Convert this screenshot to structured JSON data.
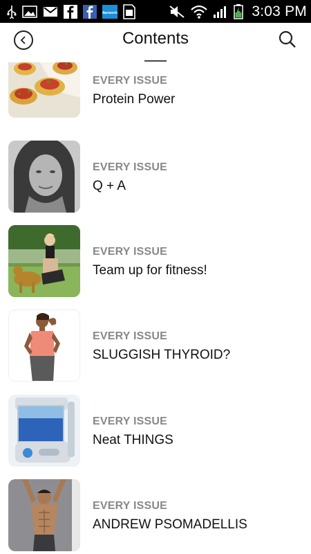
{
  "status_bar": {
    "time": "3:03 PM",
    "icons": [
      "usb-icon",
      "image-icon",
      "gmail-icon",
      "facebook-icon",
      "facebook-icon",
      "macworld-icon",
      "sim-icon",
      "mute-icon",
      "wifi-icon",
      "signal-icon",
      "battery-charging-icon"
    ],
    "macworld_label": "Macworld"
  },
  "header": {
    "title": "Contents"
  },
  "articles": [
    {
      "kicker": "EVERY ISSUE",
      "title": "Protein Power"
    },
    {
      "kicker": "EVERY ISSUE",
      "title": "Q + A"
    },
    {
      "kicker": "EVERY ISSUE",
      "title": "Team up for fitness!"
    },
    {
      "kicker": "EVERY ISSUE",
      "title": "SLUGGISH THYROID?"
    },
    {
      "kicker": "EVERY ISSUE",
      "title": "Neat THINGS"
    },
    {
      "kicker": "EVERY ISSUE",
      "title": "ANDREW PSOMADELLIS"
    }
  ]
}
